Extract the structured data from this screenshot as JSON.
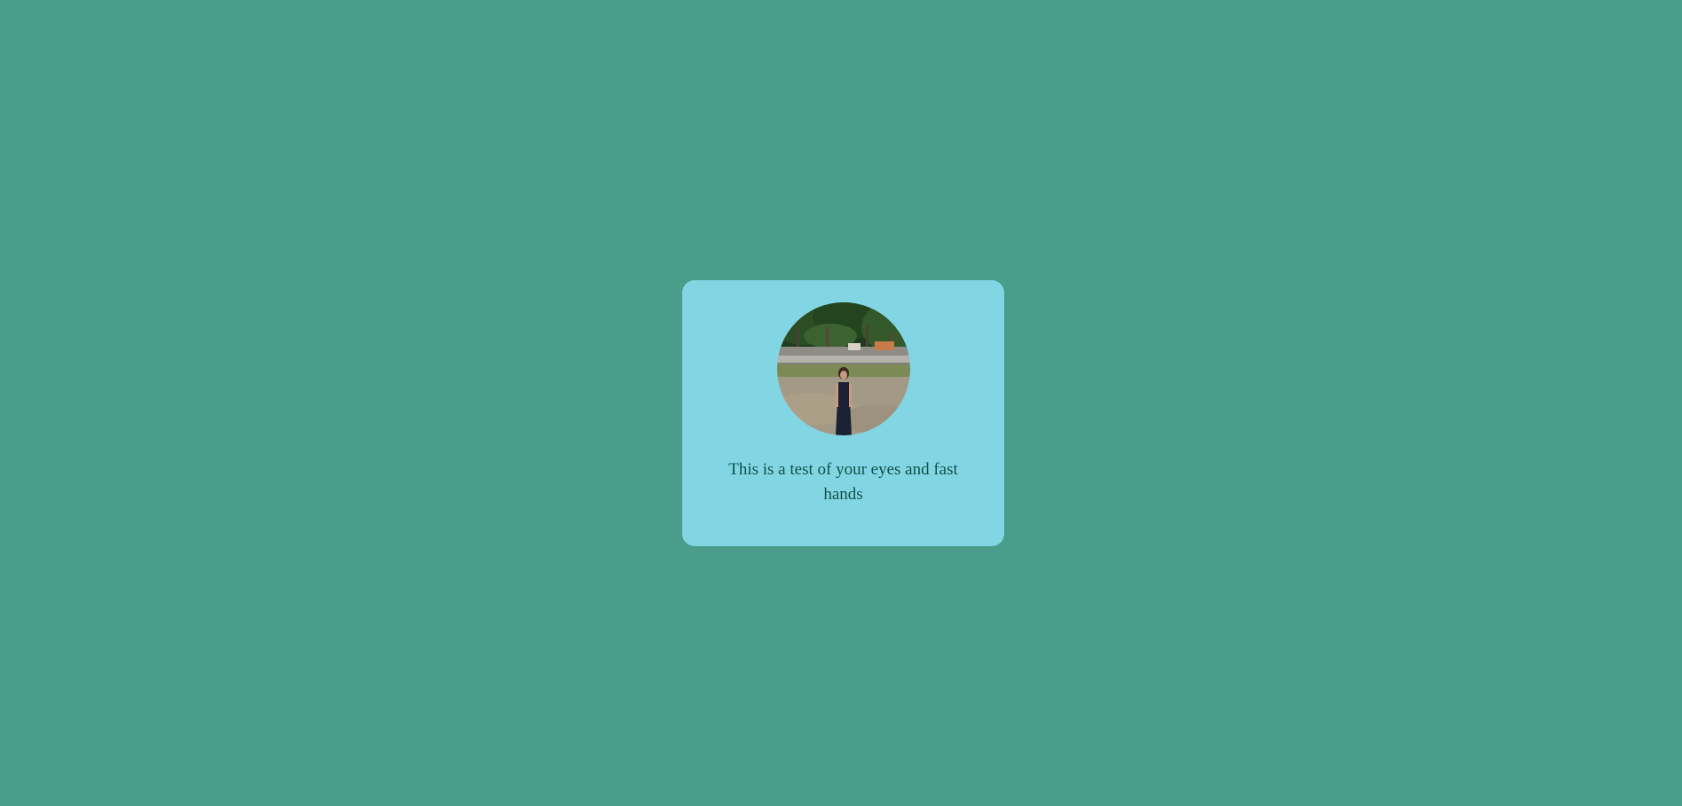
{
  "card": {
    "avatar_icon": "profile-photo",
    "caption": "This is a test of your eyes and fast hands"
  },
  "colors": {
    "page_background": "#4a9d8a",
    "card_background": "#82d5e3",
    "caption_text": "#0f5348"
  }
}
